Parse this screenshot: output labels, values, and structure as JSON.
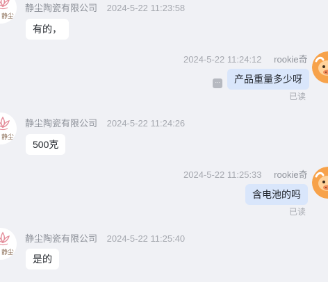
{
  "messages": [
    {
      "sender": "静尘陶瓷有限公司",
      "time": "2024-5-22 11:23:58",
      "text": "有的，",
      "avatar_label": "静尘"
    },
    {
      "sender": "rookie奇",
      "time": "2024-5-22 11:24:12",
      "text": "产品重量多少呀",
      "status": "已读",
      "more_icon": "···"
    },
    {
      "sender": "静尘陶瓷有限公司",
      "time": "2024-5-22 11:24:26",
      "text": "500克",
      "avatar_label": "静尘"
    },
    {
      "sender": "rookie奇",
      "time": "2024-5-22 11:25:33",
      "text": "含电池的吗",
      "status": "已读"
    },
    {
      "sender": "静尘陶瓷有限公司",
      "time": "2024-5-22 11:25:40",
      "text": "是的",
      "avatar_label": "静尘"
    }
  ],
  "colors": {
    "background": "#f0f1f5",
    "incoming_bubble": "#ffffff",
    "outgoing_bubble": "#d9e6fb",
    "meta_text": "#a6a9b0"
  }
}
